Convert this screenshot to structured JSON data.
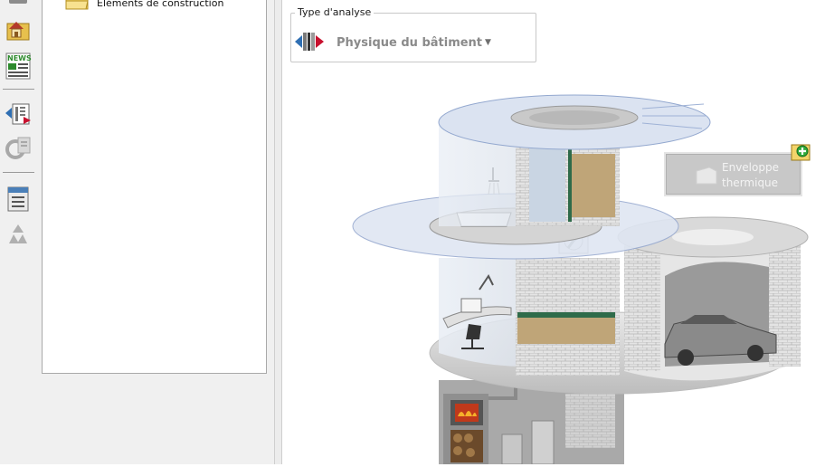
{
  "tree": {
    "items": [
      {
        "label": "Éléments de construction",
        "icon": "folder-icon"
      }
    ]
  },
  "toolbar": {
    "buttons": [
      {
        "name": "top-partial-icon"
      },
      {
        "name": "house-folder-icon"
      },
      {
        "name": "news-icon"
      },
      {
        "name": "analysis-doc-icon"
      },
      {
        "name": "recycle-doc-icon"
      },
      {
        "name": "calendar-list-icon"
      },
      {
        "name": "recycle-icon"
      }
    ]
  },
  "analysis": {
    "group_title": "Type d'analyse",
    "selected": "Physique du bâtiment",
    "icon": "wall-section-icon"
  },
  "hotspot": {
    "label": "Enveloppe thermique",
    "icon": "folder-add-icon"
  },
  "colors": {
    "panel_bg": "#f0f0f0",
    "hotspot_bg": "#c8c8c8",
    "accent_red": "#c8102e",
    "accent_blue": "#2f6fb3"
  }
}
